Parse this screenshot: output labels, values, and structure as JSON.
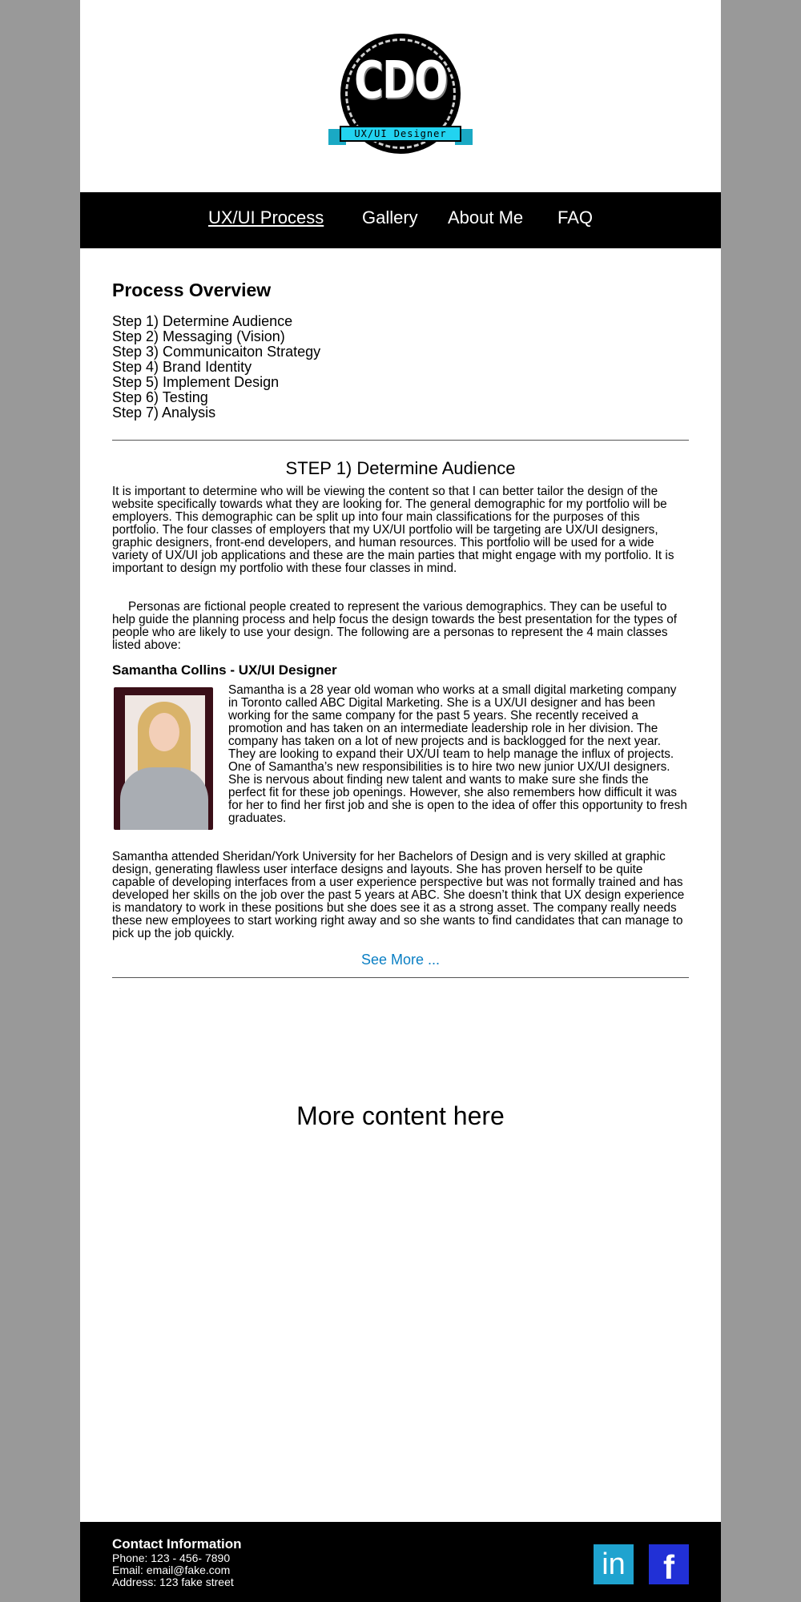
{
  "logo": {
    "text": "CDO",
    "ribbon": "UX/UI Designer"
  },
  "nav": {
    "items": [
      {
        "label": "UX/UI Process",
        "active": true
      },
      {
        "label": "Gallery",
        "active": false
      },
      {
        "label": "About Me",
        "active": false
      },
      {
        "label": "FAQ",
        "active": false
      }
    ]
  },
  "overview": {
    "title": "Process Overview",
    "steps": [
      "Step 1) Determine Audience",
      "Step 2) Messaging (Vision)",
      "Step 3) Communicaiton Strategy",
      "Step 4) Brand Identity",
      "Step 5) Implement Design",
      "Step 6) Testing",
      "Step 7) Analysis"
    ]
  },
  "step1": {
    "title": "STEP 1) Determine Audience",
    "para1": "It is important to determine who will be viewing the content so that I can better tailor the design of the website specifically towards what they are looking for. The general demographic for my portfolio will be employers. This demographic can be split up into four main classifications for the purposes of this portfolio. The four classes of employers that my UX/UI portfolio will be targeting are UX/UI designers, graphic designers, front-end developers, and human resources. This portfolio will be used for a wide variety of UX/UI job applications and these are the main parties that might engage with my portfolio. It is important to design my portfolio with these four classes in mind.",
    "para2": "Personas are fictional people created to represent the various demographics. They can be useful to help guide the planning process and help focus the design towards the best presentation for the types of people who are likely to use your design. The following are a personas to represent the 4 main classes listed above:"
  },
  "persona": {
    "name": "Samantha Collins - UX/UI Designer",
    "bio": "Samantha is a 28 year old woman who works at a small digital marketing company in Toronto called ABC Digital Marketing. She is a UX/UI designer and has been working for the same company for the past 5 years. She recently received a promotion and has taken on an intermediate leadership role in her division. The company has taken on a lot of new projects and is backlogged for the next year. They are looking to expand their UX/UI team to help manage the influx of projects. One of Samantha’s new responsibilities is to hire two new junior UX/UI designers. She is nervous about finding new talent and wants to make sure she finds the perfect fit for these job openings. However, she also remembers how difficult it was for her to find her first job and she is open to the idea of offer this opportunity to fresh graduates.",
    "bio2": "Samantha attended Sheridan/York University for her Bachelors of Design and is very skilled at graphic design, generating flawless user interface designs and layouts. She has proven herself to be quite capable of developing interfaces from a user experience perspective but was not formally trained and has developed her skills on the job over the past 5 years at ABC. She doesn’t think that UX design experience is mandatory to work in these positions but she does see it as a strong asset. The company really needs these new employees to start working right away and so she wants to find candidates that can manage to pick up the job quickly."
  },
  "see_more": "See More ...",
  "more_content": "More content here",
  "footer": {
    "title": "Contact Information",
    "phone": "Phone: 123 - 456- 7890",
    "email": "Email: email@fake.com",
    "address": "Address: 123 fake street",
    "linkedin_icon": "in",
    "facebook_icon": "f"
  },
  "colors": {
    "background": "#999999",
    "nav": "#000000",
    "link": "#0a7fc4",
    "linkedin": "#1fa3cf",
    "facebook": "#2130d6",
    "ribbon": "#22d3f0"
  }
}
